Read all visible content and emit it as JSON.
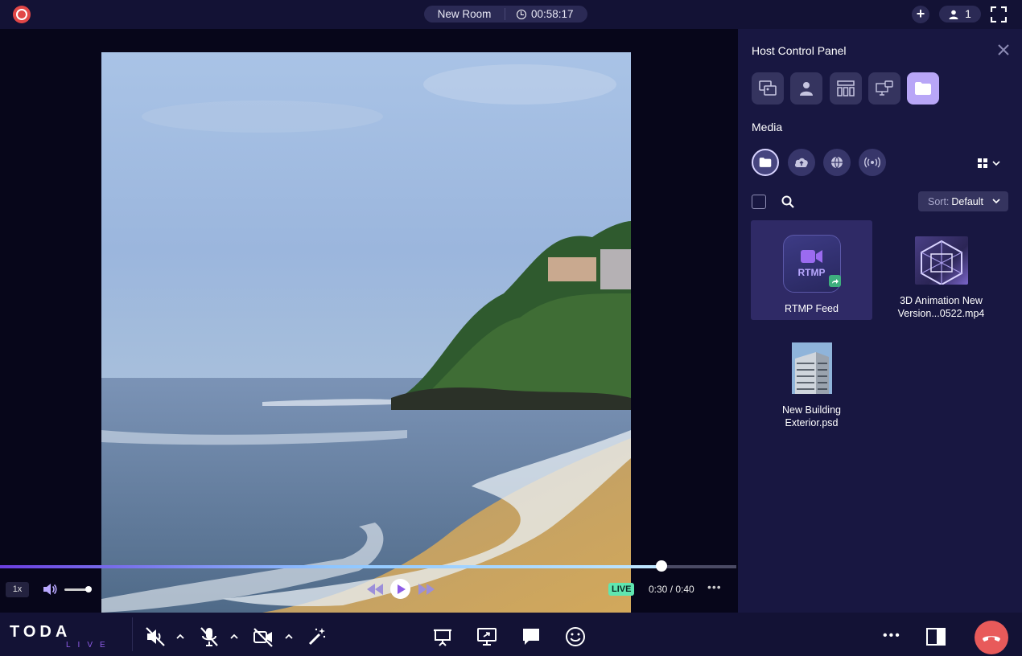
{
  "topbar": {
    "room_name": "New Room",
    "timer": "00:58:17",
    "participant_count": "1"
  },
  "player": {
    "speed": "1x",
    "live_badge": "LIVE",
    "time": "0:30 / 0:40",
    "seek_progress": 0.898,
    "volume_level": 0.85,
    "more_label": "•••"
  },
  "panel": {
    "title": "Host Control Panel",
    "tabs": [
      "screen-layout-icon",
      "participant-icon",
      "layout-grid-icon",
      "presentation-icon",
      "folder-icon"
    ],
    "active_tab": "folder-icon",
    "section_title": "Media",
    "sources": [
      "folder-icon",
      "cloud-upload-icon",
      "globe-icon",
      "broadcast-icon"
    ],
    "sort_key": "Sort:",
    "sort_value": "Default",
    "items": [
      {
        "label": "RTMP Feed",
        "tile_text": "RTMP",
        "selected": true
      },
      {
        "label": "3D Animation New Version...0522.mp4",
        "selected": false
      },
      {
        "label": "New Building Exterior.psd",
        "selected": false
      }
    ]
  },
  "bottombar": {
    "brand": "TODA",
    "brand_sub": "LIVE",
    "more_label": "•••"
  },
  "colors": {
    "accent": "#8e5ce6",
    "end_call": "#e85a5a",
    "live": "#5fe6b0",
    "record": "#e14747"
  }
}
